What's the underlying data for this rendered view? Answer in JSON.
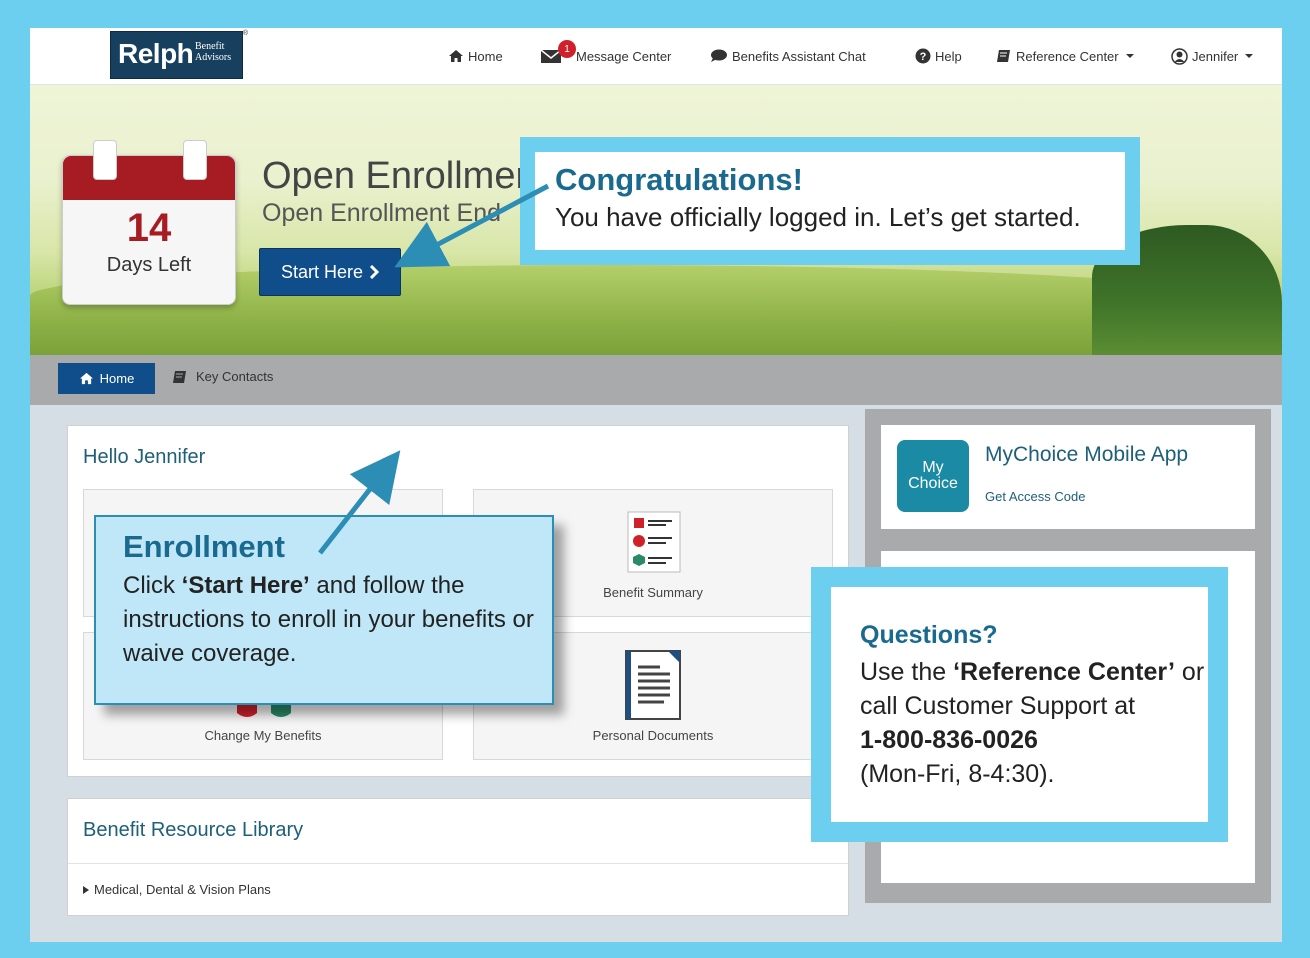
{
  "nav": {
    "logo_main": "Relph",
    "logo_sub_1": "Benefit",
    "logo_sub_2": "Advisors",
    "logo_reg": "®",
    "home": "Home",
    "message_center": "Message Center",
    "message_count": "1",
    "chat": "Benefits Assistant Chat",
    "help": "Help",
    "reference_center": "Reference Center",
    "user": "Jennifer"
  },
  "hero": {
    "days_left_number": "14",
    "days_left_label": "Days Left",
    "title": "Open Enrollmer",
    "subtitle": "Open Enrollment End",
    "start_button": "Start Here"
  },
  "subnav": {
    "home": "Home",
    "key_contacts": "Key Contacts"
  },
  "main": {
    "greeting": "Hello Jennifer",
    "tiles": {
      "benefit_summary": "Benefit Summary",
      "change_benefits": "Change My Benefits",
      "personal_documents": "Personal Documents"
    }
  },
  "library": {
    "title": "Benefit Resource Library",
    "items": [
      "Medical, Dental & Vision Plans"
    ]
  },
  "app": {
    "icon_line1": "My",
    "icon_line2": "Choice",
    "title": "MyChoice Mobile App",
    "link": "Get Access Code"
  },
  "callouts": {
    "congrats_title": "Congratulations!",
    "congrats_body": "You have officially logged in. Let’s get started.",
    "enroll_title": "Enrollment",
    "enroll_pre": "Click ",
    "enroll_bold": "‘Start Here’",
    "enroll_post": " and follow the instructions to enroll in your benefits or waive coverage.",
    "questions_title": "Questions?",
    "questions_pre": "Use the ",
    "questions_bold": "‘Reference Center’",
    "questions_mid": " or call Customer Support at",
    "questions_phone": "1-800-836-0026",
    "questions_hours": "(Mon-Fri, 8-4:30)."
  },
  "colors": {
    "frame_border": "#6ccff0",
    "primary_blue": "#0f4d8b",
    "calendar_red": "#a71b22",
    "callout_title": "#1a6a8f"
  }
}
